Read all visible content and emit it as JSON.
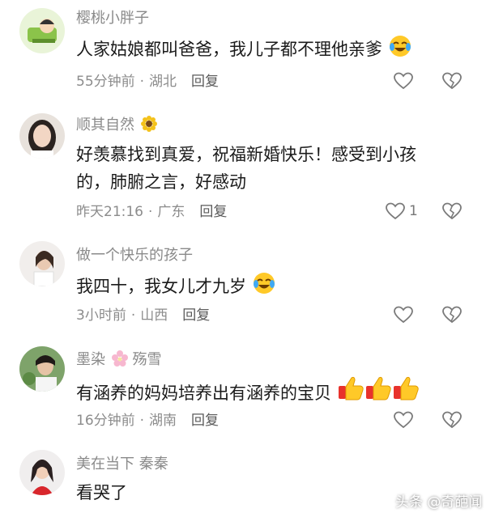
{
  "comments": [
    {
      "username": "樱桃小胖子",
      "text": "人家姑娘都叫爸爸，我儿子都不理他亲爹",
      "emoji": "laughing-crying-emoji",
      "time": "55分钟前",
      "location": "湖北",
      "reply": "回复",
      "likes": ""
    },
    {
      "username": "顺其自然",
      "username_icon": "sunflower-icon",
      "text_line1": "好羡慕找到真爱，祝福新婚快乐！感受到小孩",
      "text_line2": "的，肺腑之言，好感动",
      "time": "昨天21:16",
      "location": "广东",
      "reply": "回复",
      "likes": "1"
    },
    {
      "username": "做一个快乐的孩子",
      "text": "我四十，我女儿才九岁",
      "emoji": "laughing-crying-emoji",
      "time": "3小时前",
      "location": "山西",
      "reply": "回复",
      "likes": ""
    },
    {
      "username_a": "墨染",
      "username_b": "殇雪",
      "username_icon": "cherry-blossom-icon",
      "text": "有涵养的妈妈培养出有涵养的宝贝",
      "emoji": "thumbs-up-emoji",
      "time": "16分钟前",
      "location": "湖南",
      "reply": "回复",
      "likes": ""
    },
    {
      "username": "美在当下  秦秦",
      "text": "看哭了",
      "time": "",
      "location": "",
      "reply": "",
      "likes": ""
    }
  ],
  "separator": "·",
  "watermark": "头条 @奇葩闻",
  "colors": {
    "username": "#8a8a8a",
    "text": "#1b1b1b",
    "meta": "#8c8c8c"
  }
}
